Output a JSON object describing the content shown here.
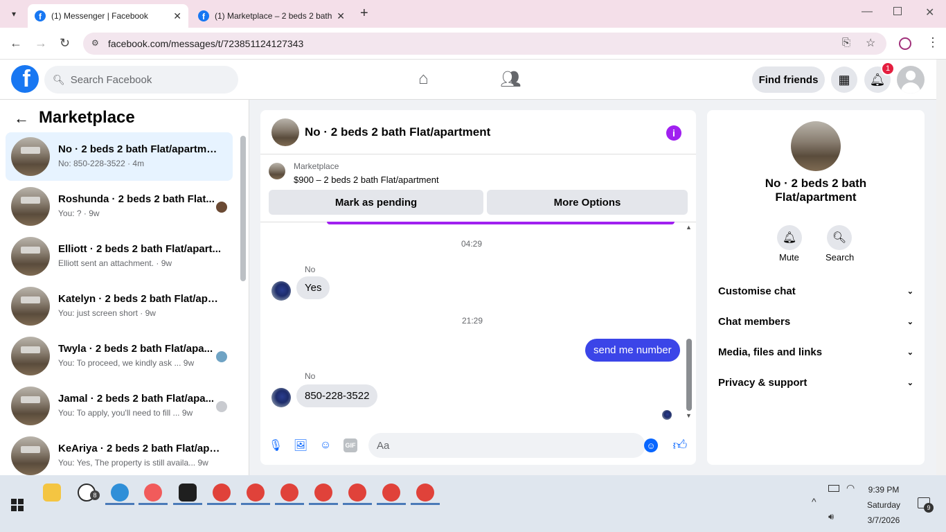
{
  "browser": {
    "tabs": [
      {
        "title": "(1) Messenger | Facebook",
        "active": true
      },
      {
        "title": "(1) Marketplace – 2 beds 2 bath",
        "active": false
      }
    ],
    "url": "facebook.com/messages/t/723851124127343"
  },
  "fb_header": {
    "logo": "f",
    "search_placeholder": "Search Facebook",
    "find_friends": "Find friends",
    "notification_count": "1"
  },
  "left_panel": {
    "title": "Marketplace",
    "conversations": [
      {
        "name": "No · 2 beds 2 bath Flat/apartment",
        "preview": "No: 850-228-3522 · 4m",
        "selected": true
      },
      {
        "name": "Roshunda · 2 beds 2 bath Flat...",
        "preview": "You: ? · 9w"
      },
      {
        "name": "Elliott · 2 beds 2 bath Flat/apart...",
        "preview": "Elliott sent an attachment. · 9w"
      },
      {
        "name": "Katelyn · 2 beds 2 bath Flat/apar...",
        "preview": "You: just screen short · 9w"
      },
      {
        "name": "Twyla · 2 beds 2 bath Flat/apa...",
        "preview": "You: To proceed, we kindly ask ...  9w"
      },
      {
        "name": "Jamal · 2 beds 2 bath Flat/apa...",
        "preview": "You: To apply, you'll need to fill ...  9w"
      },
      {
        "name": "KeAriya · 2 beds 2 bath Flat/apa...",
        "preview": "You: Yes, The property is still availa... 9w"
      }
    ]
  },
  "chat": {
    "title": "No · 2 beds 2 bath Flat/apartment",
    "marketplace_label": "Marketplace",
    "listing": "$900 – 2 beds 2 bath Flat/apartment",
    "mark_pending": "Mark as pending",
    "more_options": "More Options",
    "messages": [
      {
        "type": "time",
        "text": "04:29"
      },
      {
        "type": "sender",
        "text": "No"
      },
      {
        "type": "in",
        "text": "Yes"
      },
      {
        "type": "time",
        "text": "21:29"
      },
      {
        "type": "out",
        "text": "send me number"
      },
      {
        "type": "sender",
        "text": "No"
      },
      {
        "type": "in",
        "text": "850-228-3522"
      }
    ],
    "input_placeholder": "Aa"
  },
  "right_panel": {
    "name": "No · 2 beds 2 bath Flat/apartment",
    "mute": "Mute",
    "search": "Search",
    "sections": [
      "Customise chat",
      "Chat members",
      "Media, files and links",
      "Privacy & support"
    ]
  },
  "taskbar": {
    "whatsapp_badge": "8",
    "time": "9:39 PM",
    "day": "Saturday",
    "date": "3/7/2026",
    "notif_count": "9"
  },
  "colors": {
    "fb_blue": "#1877f2",
    "outgoing_bubble": "#3b45e8",
    "accent_purple": "#a020f0"
  }
}
